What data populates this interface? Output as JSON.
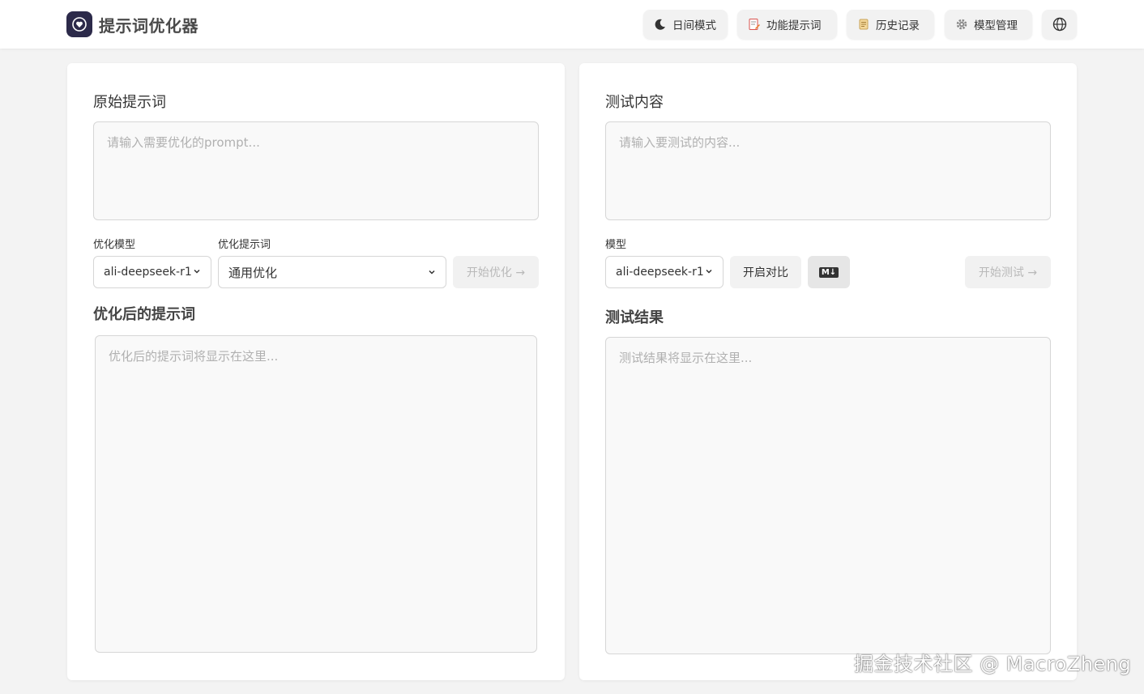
{
  "app": {
    "title": "提示词优化器"
  },
  "nav": {
    "theme": "日间模式",
    "feature_prompts": "功能提示词",
    "history": "历史记录",
    "model_manage": "模型管理"
  },
  "left": {
    "original_title": "原始提示词",
    "original_placeholder": "请输入需要优化的prompt...",
    "model_label": "优化模型",
    "model_value": "ali-deepseek-r1",
    "template_label": "优化提示词",
    "template_value": "通用优化",
    "start_button": "开始优化 →",
    "result_title": "优化后的提示词",
    "result_placeholder": "优化后的提示词将显示在这里..."
  },
  "right": {
    "test_title": "测试内容",
    "test_placeholder": "请输入要测试的内容...",
    "model_label": "模型",
    "model_value": "ali-deepseek-r1",
    "compare_button": "开启对比",
    "markdown_icon_label": "M↓",
    "start_button": "开始测试 →",
    "result_title": "测试结果",
    "result_placeholder": "测试结果将显示在这里..."
  },
  "watermark": "掘金技术社区 @ MacroZheng",
  "colors": {
    "logo_bg": "#2c2a4a",
    "card_bg": "#ffffff",
    "page_bg": "#f3f3f3"
  },
  "icons": [
    "app-logo-icon",
    "moon-icon",
    "feature-prompt-icon",
    "history-icon",
    "gear-icon",
    "globe-icon",
    "chevron-down-icon",
    "markdown-icon"
  ]
}
